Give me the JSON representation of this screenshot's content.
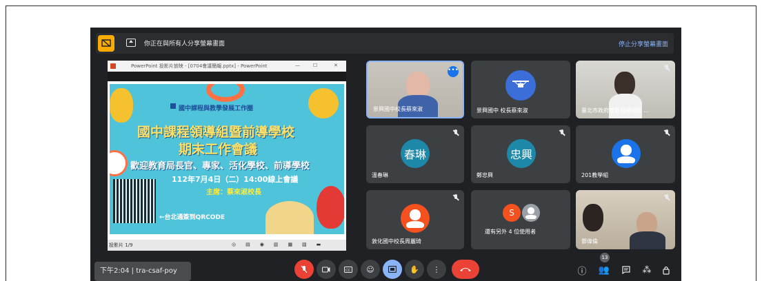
{
  "share_bar": {
    "text": "你正在與所有人分享螢幕畫面",
    "stop_label": "停止分享螢幕畫面"
  },
  "presentation": {
    "window_title": "PowerPoint 投影片放映 - [0704會議簡報.pptx] - PowerPoint",
    "slide_status": "投影片 1/9",
    "slide": {
      "org": "國中課程與教學發展工作圈",
      "title_line1": "國中課程領導組暨前導學校",
      "title_line2": "期末工作會議",
      "subtitle": "歡迎教育局長官、專家、活化學校、前導學校",
      "date": "112年7月4日（二）14:00線上會議",
      "chair": "主席：蔡來淑校長",
      "qr_label": "←台北通簽到QRCODE"
    }
  },
  "participants": [
    {
      "name": "景興國中校長蔡來淑",
      "type": "video",
      "muted": false
    },
    {
      "name": "景興國中 校長蔡來淑",
      "type": "drone",
      "muted": false
    },
    {
      "name": "臺北市政府教育局陳翊君 ...",
      "type": "video",
      "muted": true
    },
    {
      "name": "溫春琳",
      "type": "avatar",
      "avatar_text": "春琳",
      "muted": true
    },
    {
      "name": "鄭忠興",
      "type": "avatar",
      "avatar_text": "忠興",
      "muted": true
    },
    {
      "name": "201教學組",
      "type": "default",
      "muted": true
    },
    {
      "name": "敦化國中校長周麗琦",
      "type": "default",
      "muted": true
    },
    {
      "name": "還有另外 4 位使用者",
      "type": "group",
      "avatar_text": "S",
      "muted": false
    },
    {
      "name": "鄧偉倫",
      "type": "video",
      "muted": true
    }
  ],
  "bottom_bar": {
    "time": "下午2:04",
    "meeting_code": "tra-csaf-poy",
    "people_count": "13"
  },
  "colors": {
    "background": "#202124",
    "tile": "#3c4043",
    "end_call": "#ea4335",
    "share_highlight": "#f9ab00",
    "link": "#8ab4f8"
  }
}
